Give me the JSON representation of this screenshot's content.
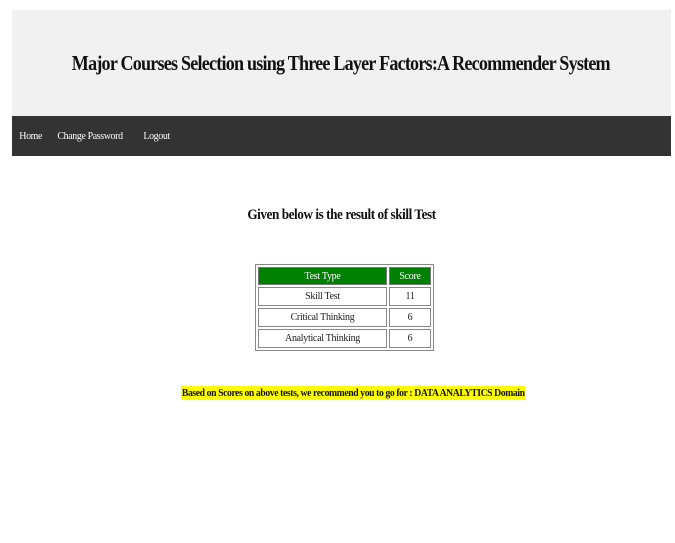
{
  "header": {
    "title": "Major Courses Selection using Three Layer Factors:A Recommender System"
  },
  "nav": {
    "home": "Home",
    "change_password": "Change Password",
    "logout": "Logout"
  },
  "main": {
    "result_title": "Given below is the result of skill Test",
    "table": {
      "headers": [
        "Test Type",
        "Score"
      ],
      "rows": [
        {
          "type": "Skill Test",
          "score": "11"
        },
        {
          "type": "Critical Thinking",
          "score": "6"
        },
        {
          "type": "Analytical Thinking",
          "score": "6"
        }
      ]
    },
    "recommendation": "Based on Scores on above tests, we recommend you to go for  : DATA ANALYTICS  Domain"
  },
  "colors": {
    "header_bg": "#f1f1f1",
    "nav_bg": "#333333",
    "table_header_bg": "#008000",
    "highlight": "#ffff00"
  }
}
